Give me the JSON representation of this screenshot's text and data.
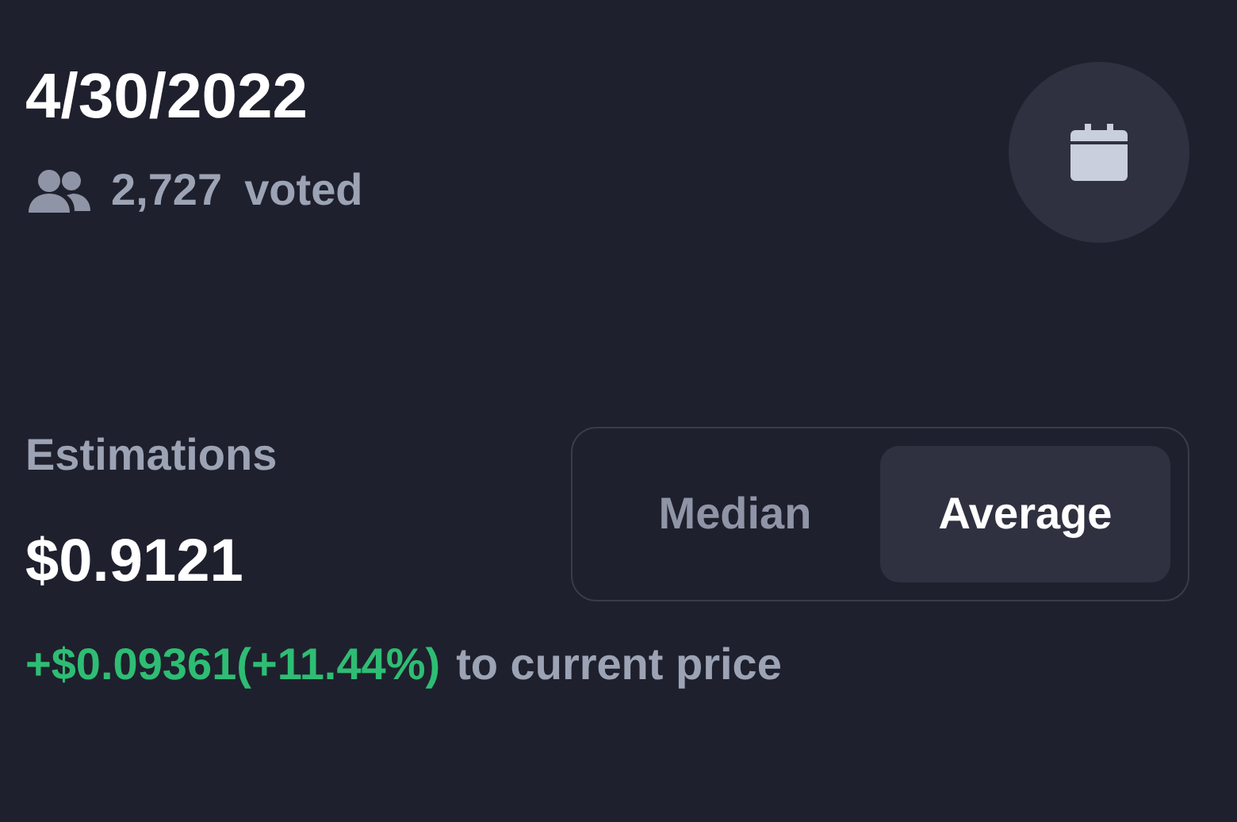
{
  "date": "4/30/2022",
  "votes": {
    "count": "2,727",
    "label": "voted"
  },
  "estimations": {
    "label": "Estimations",
    "value": "$0.9121",
    "change": "+$0.09361(+11.44%)",
    "positive": true,
    "change_suffix": "to current price"
  },
  "modes": [
    {
      "label": "Median",
      "selected": false
    },
    {
      "label": "Average",
      "selected": true
    }
  ]
}
